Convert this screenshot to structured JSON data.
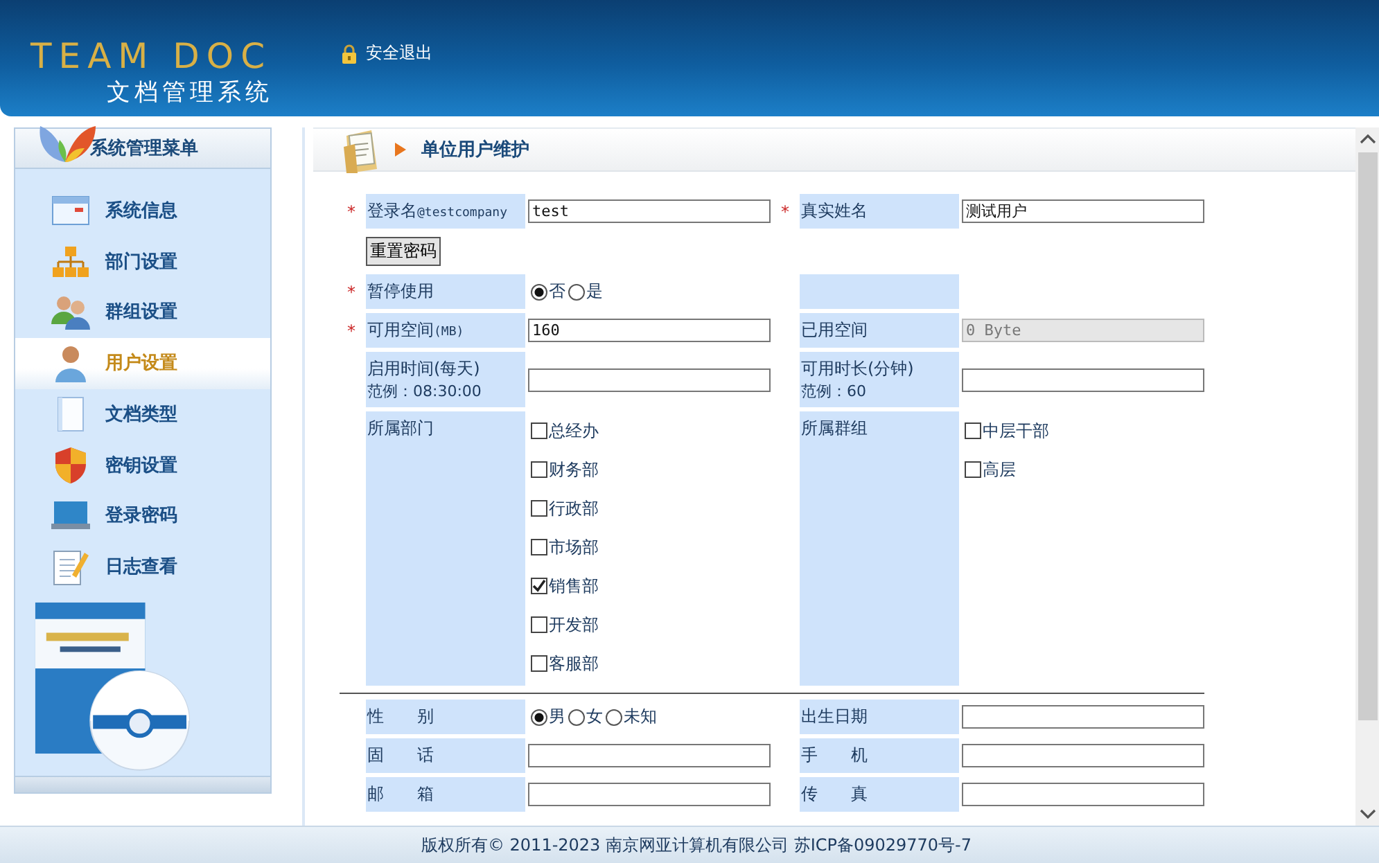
{
  "header": {
    "logo": "TEAM DOC",
    "subtitle": "文档管理系统",
    "logout": "安全退出"
  },
  "sidebar": {
    "title": "系统管理菜单",
    "items": [
      {
        "label": "系统信息",
        "selected": false
      },
      {
        "label": "部门设置",
        "selected": false
      },
      {
        "label": "群组设置",
        "selected": false
      },
      {
        "label": "用户设置",
        "selected": true
      },
      {
        "label": "文档类型",
        "selected": false
      },
      {
        "label": "密钥设置",
        "selected": false
      },
      {
        "label": "登录密码",
        "selected": false
      },
      {
        "label": "日志查看",
        "selected": false
      }
    ]
  },
  "panel": {
    "title": "单位用户维护"
  },
  "form": {
    "rows": [
      {
        "left": {
          "kind": "text",
          "required": "*",
          "label": "登录名",
          "label_suffix": "@testcompany",
          "value": "test"
        },
        "right": {
          "kind": "text",
          "required": "*",
          "label": "真实姓名",
          "value": "测试用户"
        }
      },
      {
        "left": {
          "kind": "button",
          "label": "重置密码"
        }
      },
      {
        "left": {
          "kind": "radio",
          "required": "*",
          "label": "暂停使用",
          "options": [
            {
              "label": "否",
              "selected": true
            },
            {
              "label": "是",
              "selected": false
            }
          ]
        },
        "right": {
          "kind": "blank"
        }
      },
      {
        "left": {
          "kind": "text",
          "required": "*",
          "label": "可用空间",
          "label_suffix": "(MB)",
          "value": "160"
        },
        "right": {
          "kind": "text",
          "label": "已用空间",
          "value": "0 Byte",
          "disabled": true
        }
      },
      {
        "left": {
          "kind": "text",
          "label": "启用时间(每天)",
          "hint": "范例：08:30:00"
        },
        "right": {
          "kind": "text",
          "label": "可用时长(分钟)",
          "hint": "范例：60"
        }
      },
      {
        "left": {
          "kind": "checklist",
          "label": "所属部门",
          "options": [
            {
              "label": "总经办",
              "checked": false
            },
            {
              "label": "财务部",
              "checked": false
            },
            {
              "label": "行政部",
              "checked": false
            },
            {
              "label": "市场部",
              "checked": false
            },
            {
              "label": "销售部",
              "checked": true
            },
            {
              "label": "开发部",
              "checked": false
            },
            {
              "label": "客服部",
              "checked": false
            }
          ]
        },
        "right": {
          "kind": "checklist",
          "label": "所属群组",
          "options": [
            {
              "label": "中层干部",
              "checked": false
            },
            {
              "label": "高层",
              "checked": false
            }
          ]
        }
      },
      {
        "kind": "divider"
      },
      {
        "left": {
          "kind": "radio",
          "label": "性　　别",
          "options": [
            {
              "label": "男",
              "selected": true
            },
            {
              "label": "女",
              "selected": false
            },
            {
              "label": "未知",
              "selected": false
            }
          ]
        },
        "right": {
          "kind": "text",
          "label": "出生日期"
        }
      },
      {
        "left": {
          "kind": "text",
          "label": "固　　话"
        },
        "right": {
          "kind": "text",
          "label": "手　　机"
        }
      },
      {
        "left": {
          "kind": "text",
          "label": "邮　　箱"
        },
        "right": {
          "kind": "text",
          "label": "传　　真"
        }
      }
    ]
  },
  "footer": {
    "text": "版权所有© 2011-2023 南京网亚计算机有限公司 苏ICP备09029770号-7"
  }
}
